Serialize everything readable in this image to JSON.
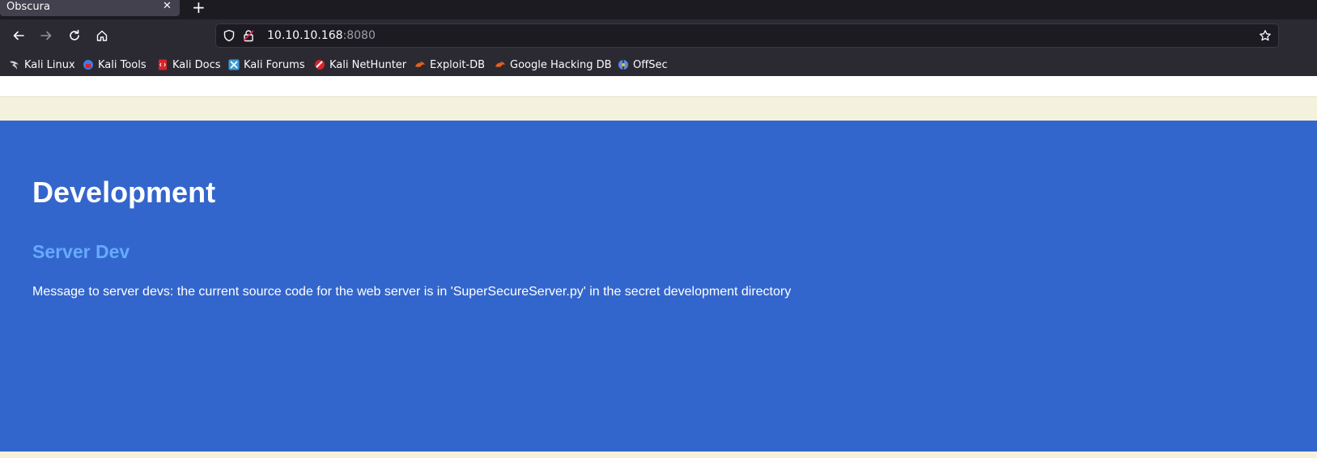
{
  "browser": {
    "tab": {
      "title": "Obscura",
      "close_glyph": "✕"
    },
    "newtab_glyph": "+",
    "nav": {
      "back_icon": "arrow-left-icon",
      "forward_icon": "arrow-right-icon",
      "reload_icon": "reload-icon",
      "home_icon": "home-icon"
    },
    "url": {
      "host": "10.10.10.168",
      "port": ":8080"
    },
    "bookmarks": [
      {
        "label": "Kali Linux",
        "icon": "kali-dragon-icon",
        "color": "#cccccc"
      },
      {
        "label": "Kali Tools",
        "icon": "kali-tools-icon",
        "color": "#3d7ee8"
      },
      {
        "label": "Kali Docs",
        "icon": "kali-docs-icon",
        "color": "#d9232a"
      },
      {
        "label": "Kali Forums",
        "icon": "kali-forums-icon",
        "color": "#3d9bd9"
      },
      {
        "label": "Kali NetHunter",
        "icon": "kali-nethunter-icon",
        "color": "#d9232a"
      },
      {
        "label": "Exploit-DB",
        "icon": "exploit-db-icon",
        "color": "#e8601c"
      },
      {
        "label": "Google Hacking DB",
        "icon": "ghdb-icon",
        "color": "#e8601c"
      },
      {
        "label": "OffSec",
        "icon": "offsec-icon",
        "color": "#5b8bd9"
      }
    ]
  },
  "page": {
    "title": "Development",
    "subtitle": "Server Dev",
    "message": "Message to server devs: the current source code for the web server is in 'SuperSecureServer.py' in the secret development directory",
    "colors": {
      "panel": "#3366cc",
      "subtitle": "#66aaff",
      "cream": "#f4f2dc"
    }
  }
}
